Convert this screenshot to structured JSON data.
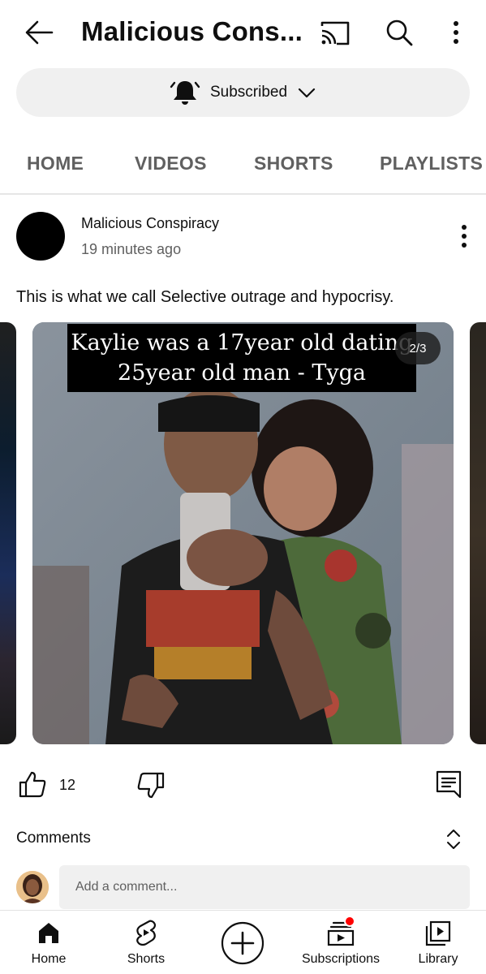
{
  "header": {
    "title": "Malicious Cons...",
    "icons": [
      "arrow-back-icon",
      "cast-icon",
      "search-icon",
      "more-vert-icon"
    ]
  },
  "subscribe": {
    "label": "Subscribed",
    "icons": [
      "bell-icon",
      "chevron-down-icon"
    ]
  },
  "tabs": [
    {
      "label": "HOME"
    },
    {
      "label": "VIDEOS"
    },
    {
      "label": "SHORTS"
    },
    {
      "label": "PLAYLISTS"
    }
  ],
  "post": {
    "channel": "Malicious Conspiracy",
    "time": "19 minutes ago",
    "text": "This is what we call Selective outrage and hypocrisy.",
    "image": {
      "caption_line1": "Kaylie was a 17year old dating",
      "caption_line2": "25year old man - Tyga",
      "counter": "2/3"
    },
    "likes": "12"
  },
  "comments": {
    "label": "Comments",
    "placeholder": "Add a comment..."
  },
  "bottom_nav": [
    {
      "label": "Home",
      "icon": "home-icon"
    },
    {
      "label": "Shorts",
      "icon": "shorts-icon"
    },
    {
      "label": "",
      "icon": "create-icon"
    },
    {
      "label": "Subscriptions",
      "icon": "subscriptions-icon"
    },
    {
      "label": "Library",
      "icon": "library-icon"
    }
  ],
  "colors": {
    "text": "#0f0f0f",
    "secondary": "#606060",
    "chip_bg": "#f0f0f0",
    "notification": "#ff0000"
  }
}
